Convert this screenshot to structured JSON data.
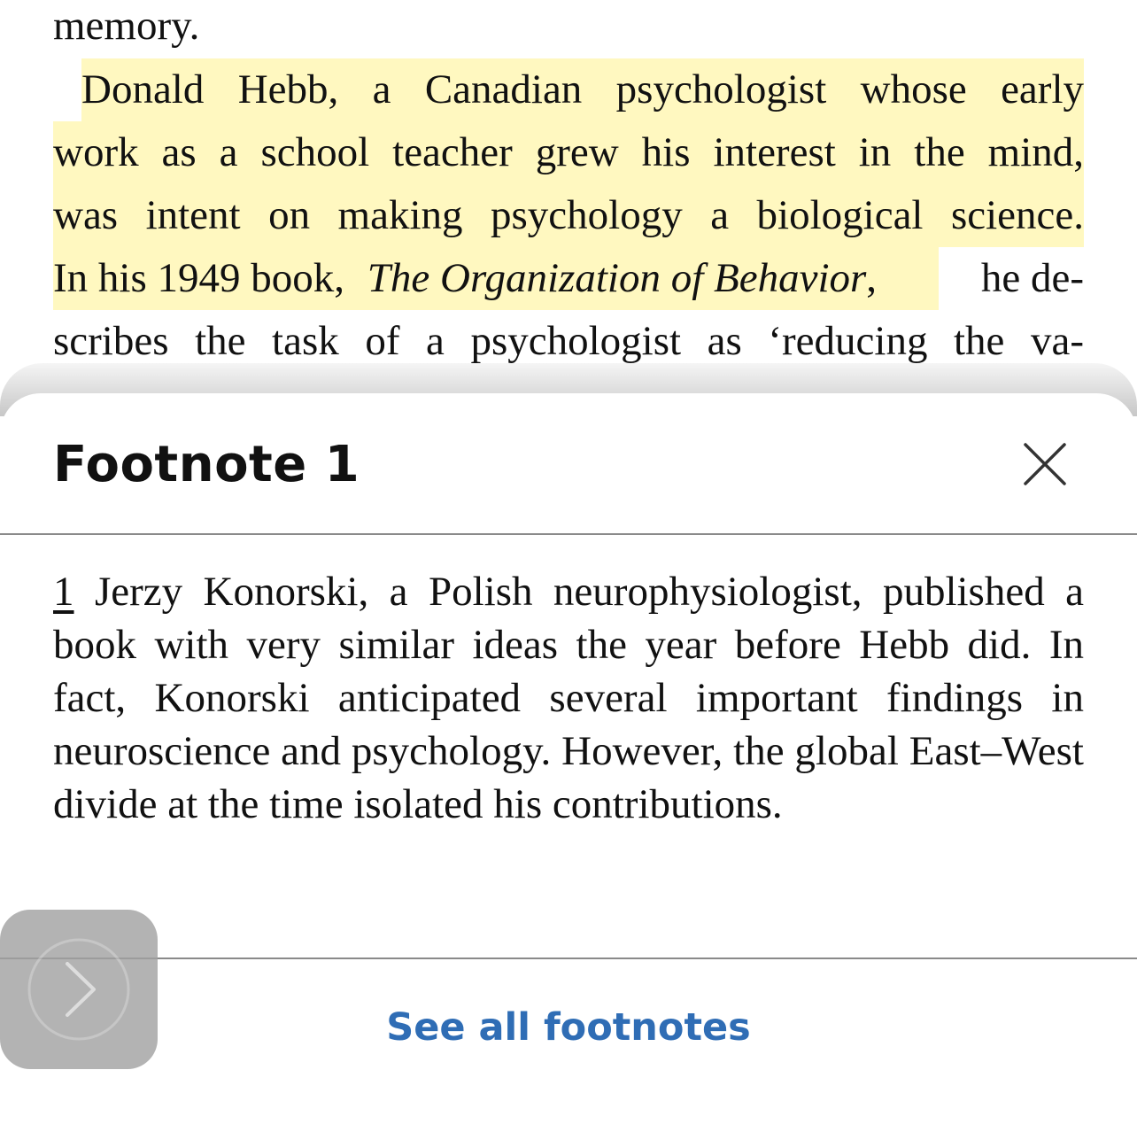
{
  "reader": {
    "lines": [
      "memory.",
      "Donald Hebb, a Canadian psychologist whose early",
      "work as a school teacher grew his interest in the mind,",
      "was intent on making psychology a biological science.",
      "In his 1949 book,",
      "The Organization of Behavior",
      ",",
      "he de-",
      "scribes the task of a psychologist as ‘reducing the va-"
    ]
  },
  "footnote_sheet": {
    "title": "Footnote 1",
    "close_icon": "close-icon",
    "footnote_number": "1",
    "footnote_text": "Jerzy Konorski, a Polish neurophysiologist, published a book with very similar ideas the year before Hebb did. In fact, Konorski anticipated several important findings in neuroscience and psychology. However, the global East–West divide at the time isolated his contributions.",
    "see_all_label": "See all footnotes"
  },
  "next_page_button": {
    "icon": "chevron-right-icon"
  },
  "colors": {
    "highlight": "#fff8c0",
    "link": "#2f6db5",
    "text": "#111111"
  }
}
